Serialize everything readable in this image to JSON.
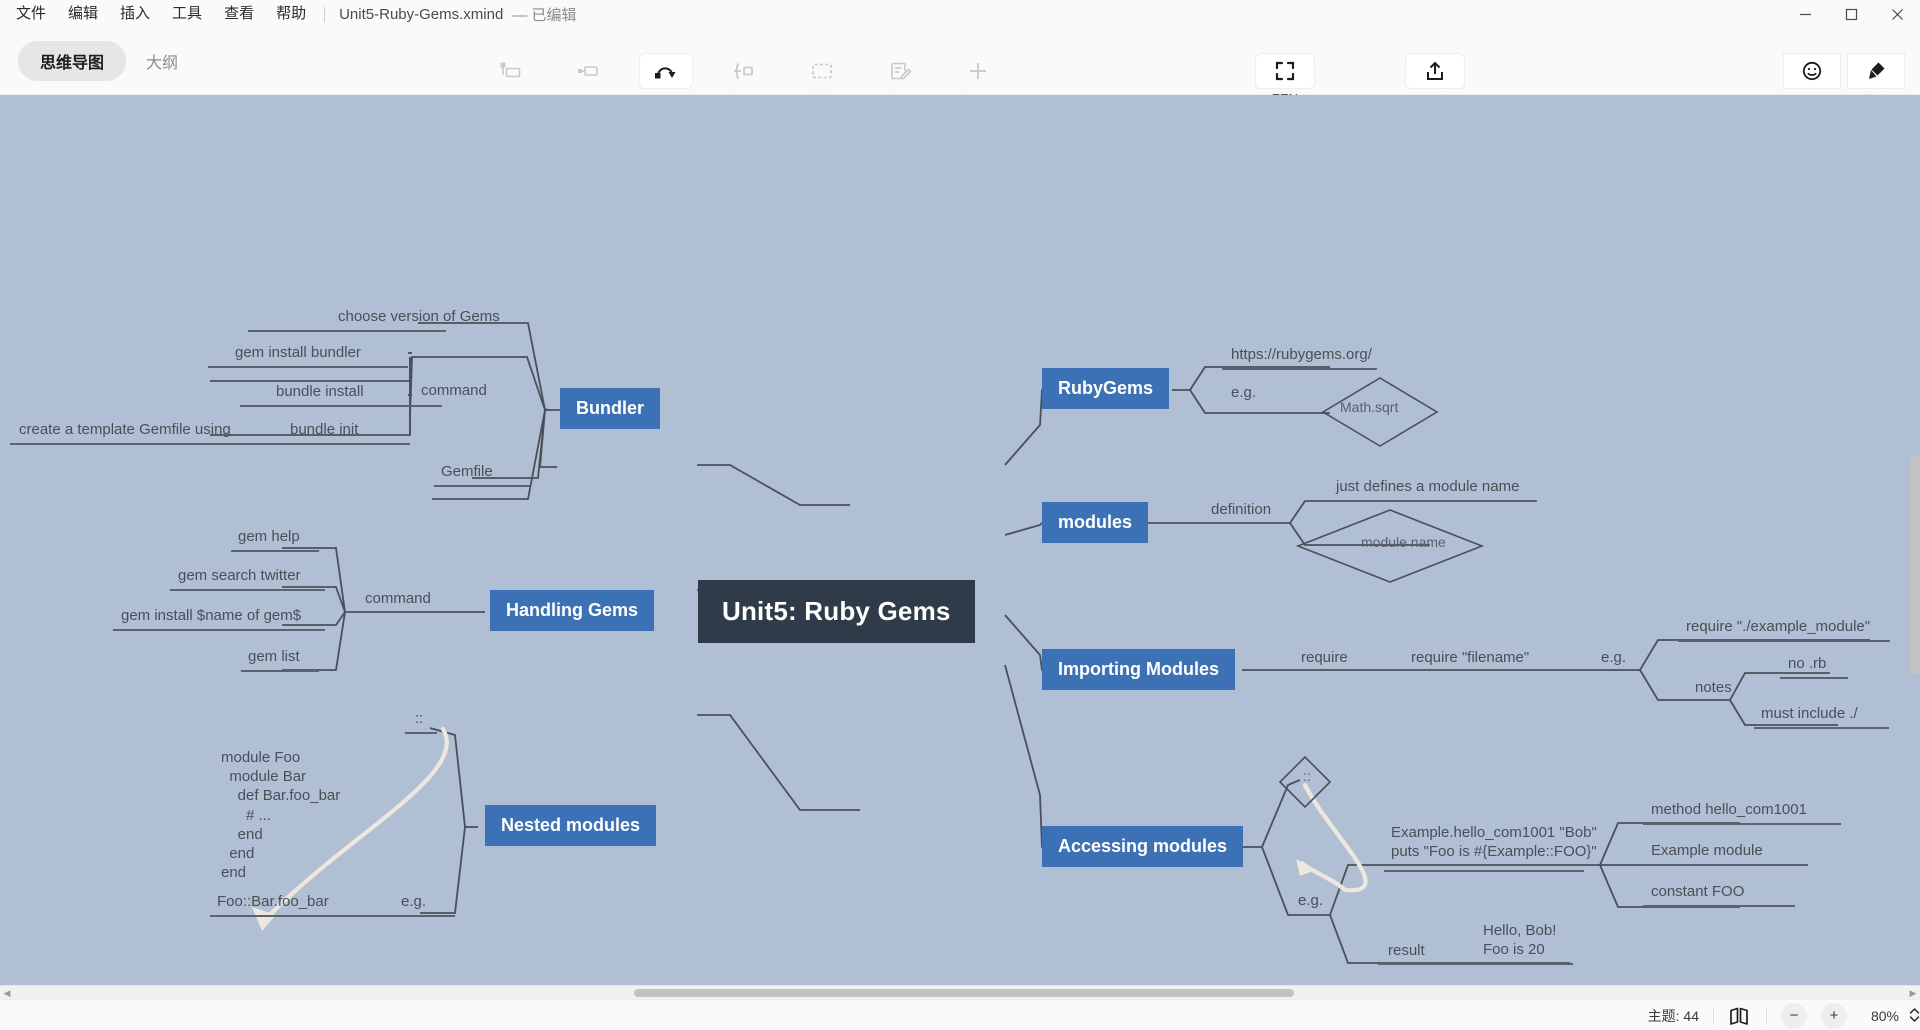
{
  "window": {
    "menu": [
      "文件",
      "编辑",
      "插入",
      "工具",
      "查看",
      "帮助"
    ],
    "document_name": "Unit5-Ruby-Gems.xmind",
    "document_state": "— 已编辑",
    "controls": {
      "minimize": "minimize-icon",
      "maximize": "maximize-icon",
      "close": "close-icon"
    }
  },
  "toolbar": {
    "modes": [
      {
        "label": "思维导图",
        "active": true
      },
      {
        "label": "大纲",
        "active": false
      }
    ],
    "center_tools": [
      {
        "label": "主题",
        "icon": "topic-icon",
        "active": false
      },
      {
        "label": "子主题",
        "icon": "subtopic-icon",
        "active": false
      },
      {
        "label": "联系",
        "icon": "relationship-icon",
        "active": true
      },
      {
        "label": "概要",
        "icon": "summary-icon",
        "active": false
      },
      {
        "label": "外框",
        "icon": "boundary-icon",
        "active": false
      },
      {
        "label": "笔记",
        "icon": "note-icon",
        "active": false
      },
      {
        "label": "插入",
        "icon": "plus-icon",
        "active": false
      }
    ],
    "zen_tools": [
      {
        "label": "ZEN",
        "icon": "fullscreen-icon"
      },
      {
        "label": "分享",
        "icon": "share-icon"
      }
    ],
    "right_tools": [
      {
        "label": "图标",
        "icon": "smiley-icon"
      },
      {
        "label": "格式",
        "icon": "brush-icon"
      }
    ]
  },
  "statusbar": {
    "topic_count_label": "主题: 44",
    "map_icon": "map-icon",
    "zoom_out": "−",
    "zoom_in": "+",
    "zoom_level": "80%",
    "spinner": "spinner-icon"
  },
  "colors": {
    "canvas": "#b0bfd3",
    "central_node": "#303b49",
    "main_node": "#3c72b5",
    "line": "#49505a",
    "relationship": "#ece8dd"
  },
  "mindmap": {
    "central": "Unit5: Ruby Gems",
    "main_topics": [
      {
        "id": "bundler",
        "label": "Bundler",
        "side": "left"
      },
      {
        "id": "handling",
        "label": "Handling Gems",
        "side": "left"
      },
      {
        "id": "nested",
        "label": "Nested modules",
        "side": "left"
      },
      {
        "id": "rubygems",
        "label": "RubyGems",
        "side": "right"
      },
      {
        "id": "modules",
        "label": "modules",
        "side": "right"
      },
      {
        "id": "importing",
        "label": "Importing Modules",
        "side": "right"
      },
      {
        "id": "accessing",
        "label": "Accessing modules",
        "side": "right"
      }
    ],
    "nodes": {
      "bundler_command": "command",
      "bundler_choose_version": "choose version of Gems",
      "bundler_gem_install_bundler": "gem install bundler",
      "bundler_bundle_install": "bundle install",
      "bundler_bundle_init": "bundle init",
      "bundler_create_template": "create a template Gemfile using",
      "bundler_gemfile": "Gemfile",
      "handling_command": "command",
      "handling_gem_help": "gem help",
      "handling_gem_search": "gem search twitter",
      "handling_gem_install": "gem install $name of gem$",
      "handling_gem_list": "gem list",
      "nested_scope": "::",
      "nested_code": "module Foo\n  module Bar\n    def Bar.foo_bar\n      # ...\n    end\n  end\nend",
      "nested_eg": "e.g.",
      "nested_call": "Foo::Bar.foo_bar",
      "rubygems_url": "https://rubygems.org/",
      "rubygems_eg": "e.g.",
      "rubygems_mathsqrt": "Math.sqrt",
      "modules_definition": "definition",
      "modules_just_defines": "just defines a module name",
      "modules_module_name": "module name",
      "importing_require": "require",
      "importing_require_filename": "require \"filename\"",
      "importing_eg": "e.g.",
      "importing_require_example": "require \"./example_module\"",
      "importing_notes": "notes",
      "importing_no_rb": "no .rb",
      "importing_must_include": "must include ./",
      "accessing_scope": "::",
      "accessing_eg": "e.g.",
      "accessing_code": "Example.hello_com1001 \"Bob\"\nputs \"Foo is #{Example::FOO}\"",
      "accessing_method": "method hello_com1001",
      "accessing_example_module": "Example module",
      "accessing_constant": "constant FOO",
      "accessing_result": "result",
      "accessing_output": "Hello, Bob!\nFoo is 20"
    }
  }
}
